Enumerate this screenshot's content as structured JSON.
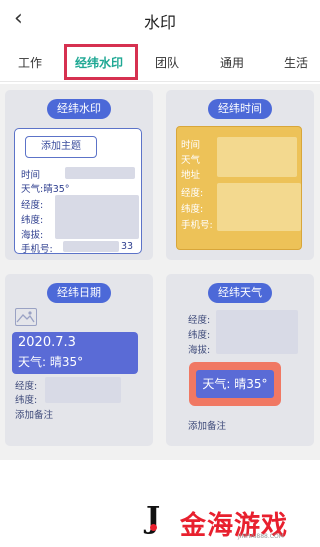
{
  "header": {
    "back_glyph": "‹",
    "title": "水印"
  },
  "tabs": [
    "工作",
    "经纬水印",
    "团队",
    "通用",
    "生活"
  ],
  "active_tab": "经纬水印",
  "card1": {
    "pill": "经纬水印",
    "add_theme": "添加主题",
    "lines": [
      "时间",
      "天气:晴35°",
      "经度:",
      "纬度:",
      "海拔:",
      "手机号:"
    ],
    "phone_tail": "33"
  },
  "card2": {
    "pill": "经纬时间",
    "lines": [
      "时间",
      "天气",
      "地址",
      "经度:",
      "纬度:",
      "手机号:"
    ]
  },
  "card3": {
    "pill": "经纬日期",
    "date": "2020.7.3",
    "weather": "天气: 晴35°",
    "lines": [
      "经度:",
      "纬度:"
    ],
    "add_note": "添加备注"
  },
  "card4": {
    "pill": "经纬天气",
    "lines": [
      "经度:",
      "纬度:",
      "海拔:"
    ],
    "weather": "天气: 晴35°",
    "add_note": "添加备注"
  },
  "watermark": {
    "brand": "金海游戏",
    "url": "JINHAI888.COM",
    "logo_letter": "J"
  }
}
